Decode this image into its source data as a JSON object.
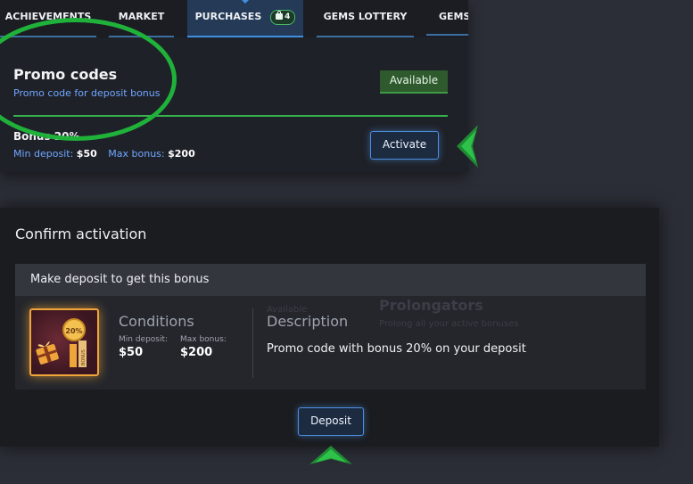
{
  "tabs": [
    {
      "label": "ACHIEVEMENTS"
    },
    {
      "label": "MARKET"
    },
    {
      "label": "PURCHASES",
      "badge": "4"
    },
    {
      "label": "GEMS LOTTERY"
    },
    {
      "label": "GEMS"
    }
  ],
  "promo": {
    "title": "Promo codes",
    "subtitle": "Promo code for deposit bonus",
    "status": "Available",
    "bonus_name": "Bonus 20%",
    "min_deposit_label": "Min deposit:",
    "min_deposit": "$50",
    "max_bonus_label": "Max bonus:",
    "max_bonus": "$200",
    "activate_label": "Activate"
  },
  "modal": {
    "title": "Confirm activation",
    "header": "Make deposit to get this bonus",
    "conditions_title": "Conditions",
    "min_deposit_label": "Min deposit:",
    "min_deposit": "$50",
    "max_bonus_label": "Max bonus:",
    "max_bonus": "$200",
    "description_title": "Description",
    "description": "Promo code with bonus 20% on your deposit",
    "deposit_label": "Deposit",
    "icon_percent": "20%",
    "icon_word": "BONUS"
  },
  "background": {
    "ghost_available": "Available",
    "ghost_title": "Prolongators",
    "ghost_sub": "Prolong all your active bonuses"
  },
  "colors": {
    "accent_blue": "#4a8fe0",
    "accent_green": "#37b14c",
    "panel": "#1f2128",
    "page": "#2b2e36"
  }
}
